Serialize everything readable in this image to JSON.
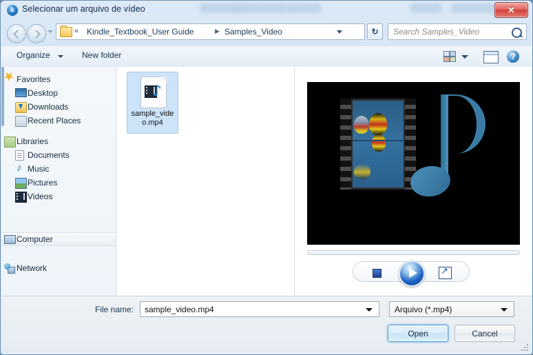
{
  "window": {
    "title": "Selecionar um arquivo de vídeo",
    "app_icon": "kindle-k-icon",
    "close_label": "✕"
  },
  "navigation": {
    "back_label": "Back",
    "forward_label": "Forward",
    "recent_dropdown_label": "Recent pages",
    "address": {
      "chevrons": "«",
      "separator": "▶",
      "crumbs": [
        "Kindle_Textbook_User Guide",
        "Samples_Video"
      ]
    },
    "refresh_label": "↻",
    "search": {
      "placeholder": "Search Samples_Video",
      "value": ""
    }
  },
  "toolbar": {
    "organize_label": "Organize",
    "new_folder_label": "New folder",
    "view_label": "Change your view",
    "preview_pane_label": "Show the preview pane",
    "help_label": "?"
  },
  "sidebar": {
    "groups": [
      {
        "header": {
          "label": "Favorites",
          "icon": "star-icon"
        },
        "items": [
          {
            "label": "Desktop",
            "icon": "desktop-icon"
          },
          {
            "label": "Downloads",
            "icon": "downloads-icon"
          },
          {
            "label": "Recent Places",
            "icon": "recent-places-icon"
          }
        ]
      },
      {
        "header": {
          "label": "Libraries",
          "icon": "libraries-icon"
        },
        "items": [
          {
            "label": "Documents",
            "icon": "documents-icon"
          },
          {
            "label": "Music",
            "icon": "music-icon"
          },
          {
            "label": "Pictures",
            "icon": "pictures-icon"
          },
          {
            "label": "Videos",
            "icon": "videos-icon"
          }
        ]
      },
      {
        "header": {
          "label": "Computer",
          "icon": "computer-icon",
          "selected": true
        },
        "items": []
      },
      {
        "header": {
          "label": "Network",
          "icon": "network-icon"
        },
        "items": []
      }
    ]
  },
  "filelist": {
    "items": [
      {
        "label": "sample_video.mp4",
        "icon": "video-file-icon",
        "selected": true
      }
    ]
  },
  "preview": {
    "thumbnail_alt": "film-strip-and-music-note-media-placeholder",
    "controls": {
      "stop_label": "Stop",
      "play_label": "Play",
      "fullscreen_label": "Full screen"
    }
  },
  "bottom": {
    "filename_label": "File name:",
    "filename_value": "sample_video.mp4",
    "filetype_value": "Arquivo (*.mp4)",
    "open_label": "Open",
    "cancel_label": "Cancel"
  }
}
